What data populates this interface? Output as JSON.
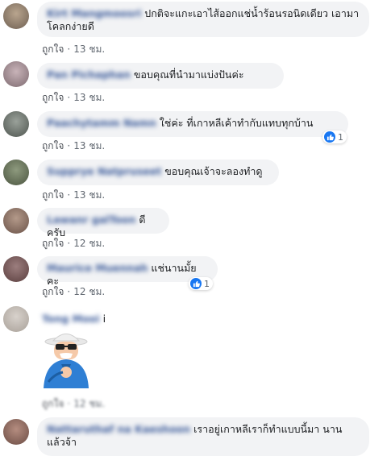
{
  "comments": [
    {
      "name": "Kirt Mangmoosri",
      "text": "ปกติจะแกะเอาไส้ออกแช่น้ำร้อนรอนิดเดียว เอามาโคลกง่ายดี",
      "like": "ถูกใจ",
      "time": "13 ชม."
    },
    {
      "name": "Pan Pichaphan",
      "text": "ขอบคุณที่นำมาแบ่งปันค่ะ",
      "like": "ถูกใจ",
      "time": "13 ชม."
    },
    {
      "name": "Paachytamm Namn",
      "text": "ใช่ค่ะ ที่เกาหลีเค้าทำกับแทบทุกบ้าน",
      "like": "ถูกใจ",
      "time": "13 ชม.",
      "reactions": "1"
    },
    {
      "name": "Supprye Natpruseet",
      "text": "ขอบคุณเจ้าจะลองทำดู",
      "like": "ถูกใจ",
      "time": "13 ชม."
    },
    {
      "name": "Lawanr galToon",
      "text": "ดีครับ",
      "like": "ถูกใจ",
      "time": "12 ชม."
    },
    {
      "name": "Maurice Muennah",
      "text": "แช่นานมั้ยคะ",
      "like": "ถูกใจ",
      "time": "12 ชม.",
      "reactions": "1"
    },
    {
      "name": "Tong Mooi",
      "text": "i",
      "like": "ถูกใจ",
      "time": "12 ชม."
    },
    {
      "name": "Nattaruthaf na Kaeshoon",
      "text": "เราอยู่เกาหลีเราก็ทำแบบนี้มา นานแล้วจ้า",
      "like": "ถูกใจ",
      "time": "12 ชม."
    }
  ],
  "icons": {
    "like_badge": "thumbs-up-icon"
  },
  "colors": {
    "bubble": "#f2f3f5",
    "name": "#385898",
    "like_badge": "#1877f2"
  }
}
